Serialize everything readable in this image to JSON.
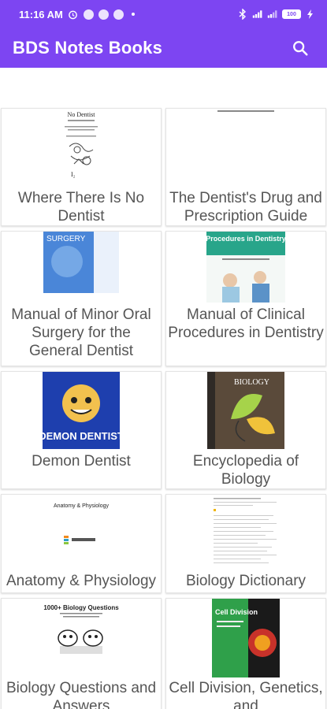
{
  "status_bar": {
    "time": "11:16 AM",
    "battery": "100"
  },
  "app_bar": {
    "title": "BDS Notes Books",
    "search_icon": "search-icon"
  },
  "books": [
    {
      "title": "Where There Is No Dentist",
      "cover_text": "No Dentist"
    },
    {
      "title": "The Dentist's Drug and Prescription Guide",
      "cover_text": ""
    },
    {
      "title": "Manual of Minor Oral Surgery for the General Dentist",
      "cover_text": "SURGERY"
    },
    {
      "title": "Manual of Clinical Procedures in Dentistry",
      "cover_text": "Procedures in Dentistry"
    },
    {
      "title": "Demon Dentist",
      "cover_text": "DEMON DENTIST"
    },
    {
      "title": "Encyclopedia of Biology",
      "cover_text": "BIOLOGY"
    },
    {
      "title": "Anatomy & Physiology",
      "cover_text": "Anatomy & Physiology"
    },
    {
      "title": "Biology Dictionary",
      "cover_text": ""
    },
    {
      "title": "Biology Questions and Answers",
      "cover_text": "1000+ Biology Questions"
    },
    {
      "title": "Cell Division, Genetics, and",
      "cover_text": "Cell Division"
    }
  ],
  "colors": {
    "primary": "#7d45f2",
    "label": "#555555"
  }
}
